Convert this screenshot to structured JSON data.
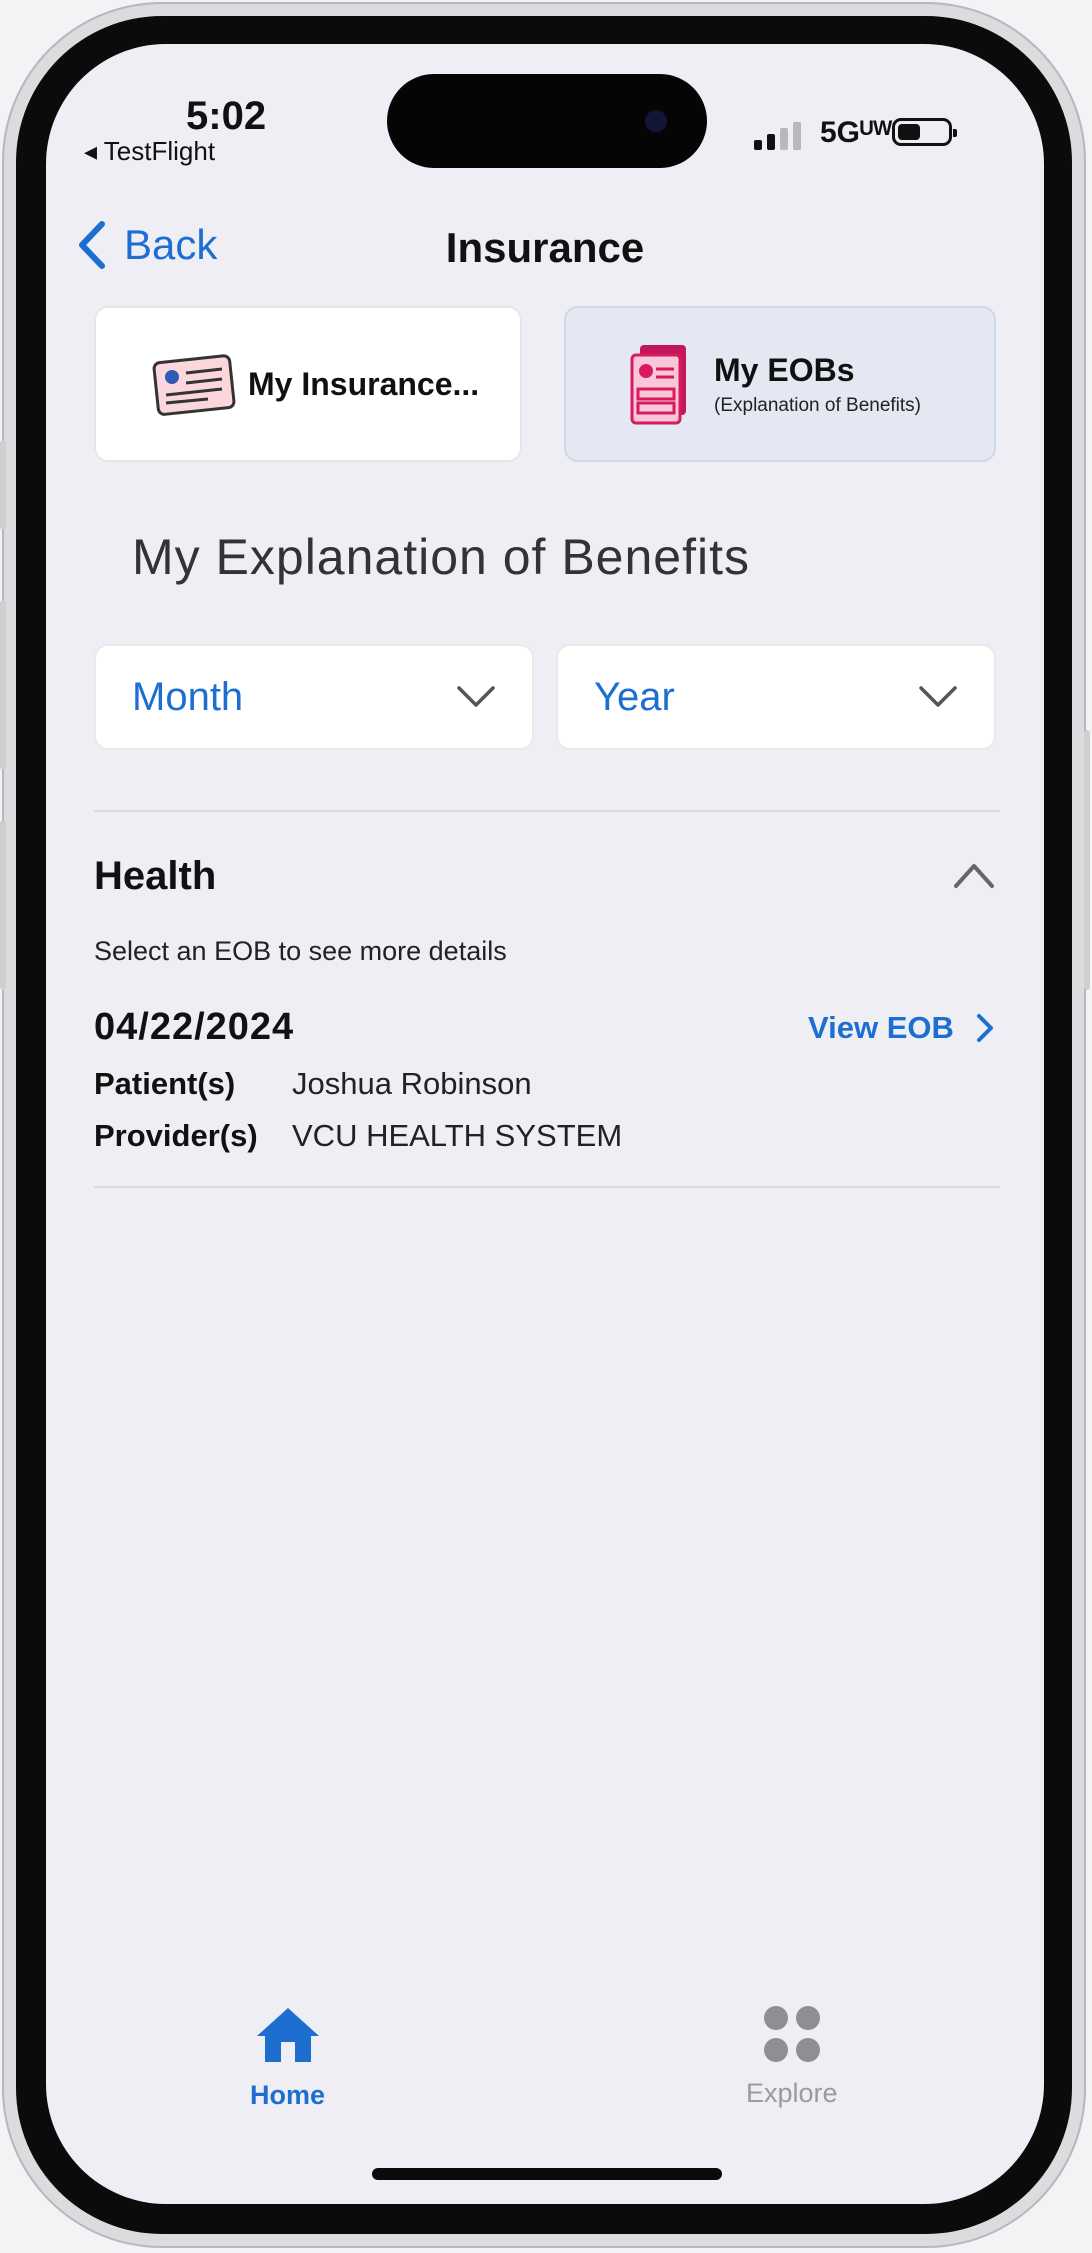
{
  "status_bar": {
    "time": "5:02",
    "back_app": "◂ TestFlight",
    "network": "5Gᵁᵂ"
  },
  "nav": {
    "back_label": "Back",
    "title": "Insurance"
  },
  "cards": {
    "insurance_label": "My Insurance...",
    "eob_label": "My EOBs",
    "eob_sublabel": "(Explanation of Benefits)"
  },
  "section_title": "My Explanation of Benefits",
  "filters": {
    "month_value": "Month",
    "year_value": "Year"
  },
  "accordion": {
    "title": "Health",
    "subtitle": "Select an EOB to see more details"
  },
  "eob_item": {
    "date": "04/22/2024",
    "view_label": "View EOB",
    "patient_label": "Patient(s)",
    "patient_value": "Joshua Robinson",
    "provider_label": "Provider(s)",
    "provider_value": "VCU HEALTH SYSTEM"
  },
  "tabbar": {
    "home_label": "Home",
    "explore_label": "Explore"
  },
  "colors": {
    "accent": "#1c6fd1",
    "background": "#efeef4",
    "selected_card": "#e3e8f2",
    "inactive_tab": "#9a9aa0",
    "eob_icon": "#d81b60"
  }
}
